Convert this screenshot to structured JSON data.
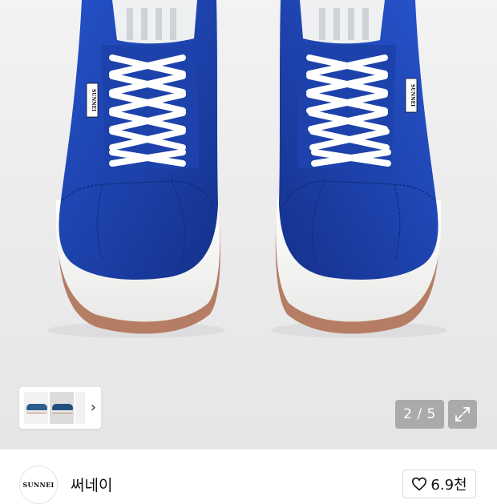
{
  "gallery": {
    "counter": "2 / 5",
    "current_index": 2,
    "total_images": 5,
    "more_icon": "chevron-right-icon",
    "expand_icon": "expand-icon",
    "shoe_label_text": "SUNNEI"
  },
  "brand": {
    "logo_text": "SUNNEI",
    "name": "써네이"
  },
  "like": {
    "icon": "heart-icon",
    "count": "6.9천"
  },
  "colors": {
    "shoe_blue": "#1d3fa8",
    "sole_white": "#f4f4f2",
    "outsole_brown": "#b07a62",
    "counter_bg": "#8a8a8a"
  }
}
